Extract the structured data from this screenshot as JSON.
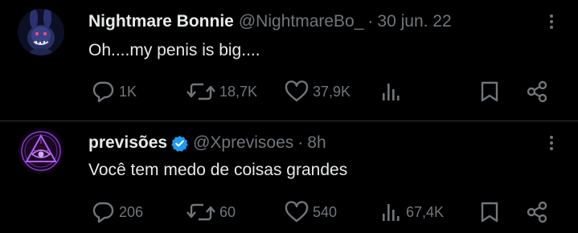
{
  "tweets": [
    {
      "name": "Nightmare Bonnie",
      "handle": "@NightmareBo_",
      "separator": "·",
      "time": "30 jun. 22",
      "text": "Oh....my penis is big....",
      "verified": false,
      "stats": {
        "replies": "1K",
        "retweets": "18,7K",
        "likes": "37,9K",
        "views": ""
      }
    },
    {
      "name": "previsões",
      "handle": "@Xprevisoes",
      "separator": "·",
      "time": "8h",
      "text": "Você tem medo de coisas grandes",
      "verified": true,
      "stats": {
        "replies": "206",
        "retweets": "60",
        "likes": "540",
        "views": "67,4K"
      }
    }
  ],
  "colors": {
    "background": "#000000",
    "text": "#e7e9ea",
    "secondary": "#71767b",
    "verified": "#1d9bf0",
    "divider": "#2f3336"
  },
  "icons": [
    "reply-icon",
    "retweet-icon",
    "like-icon",
    "views-icon",
    "bookmark-icon",
    "share-icon",
    "more-icon",
    "verified-badge-icon"
  ]
}
